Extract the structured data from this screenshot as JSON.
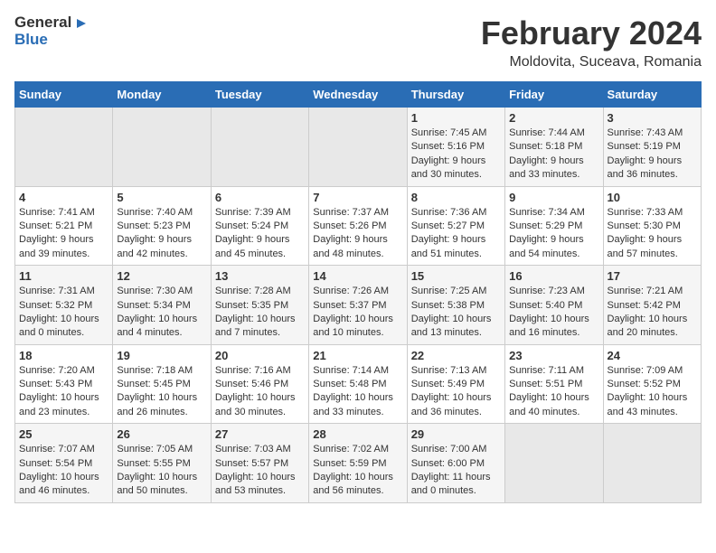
{
  "header": {
    "logo_general": "General",
    "logo_blue": "Blue",
    "title": "February 2024",
    "subtitle": "Moldovita, Suceava, Romania"
  },
  "calendar": {
    "days_of_week": [
      "Sunday",
      "Monday",
      "Tuesday",
      "Wednesday",
      "Thursday",
      "Friday",
      "Saturday"
    ],
    "weeks": [
      [
        {
          "day": "",
          "info": ""
        },
        {
          "day": "",
          "info": ""
        },
        {
          "day": "",
          "info": ""
        },
        {
          "day": "",
          "info": ""
        },
        {
          "day": "1",
          "info": "Sunrise: 7:45 AM\nSunset: 5:16 PM\nDaylight: 9 hours and 30 minutes."
        },
        {
          "day": "2",
          "info": "Sunrise: 7:44 AM\nSunset: 5:18 PM\nDaylight: 9 hours and 33 minutes."
        },
        {
          "day": "3",
          "info": "Sunrise: 7:43 AM\nSunset: 5:19 PM\nDaylight: 9 hours and 36 minutes."
        }
      ],
      [
        {
          "day": "4",
          "info": "Sunrise: 7:41 AM\nSunset: 5:21 PM\nDaylight: 9 hours and 39 minutes."
        },
        {
          "day": "5",
          "info": "Sunrise: 7:40 AM\nSunset: 5:23 PM\nDaylight: 9 hours and 42 minutes."
        },
        {
          "day": "6",
          "info": "Sunrise: 7:39 AM\nSunset: 5:24 PM\nDaylight: 9 hours and 45 minutes."
        },
        {
          "day": "7",
          "info": "Sunrise: 7:37 AM\nSunset: 5:26 PM\nDaylight: 9 hours and 48 minutes."
        },
        {
          "day": "8",
          "info": "Sunrise: 7:36 AM\nSunset: 5:27 PM\nDaylight: 9 hours and 51 minutes."
        },
        {
          "day": "9",
          "info": "Sunrise: 7:34 AM\nSunset: 5:29 PM\nDaylight: 9 hours and 54 minutes."
        },
        {
          "day": "10",
          "info": "Sunrise: 7:33 AM\nSunset: 5:30 PM\nDaylight: 9 hours and 57 minutes."
        }
      ],
      [
        {
          "day": "11",
          "info": "Sunrise: 7:31 AM\nSunset: 5:32 PM\nDaylight: 10 hours and 0 minutes."
        },
        {
          "day": "12",
          "info": "Sunrise: 7:30 AM\nSunset: 5:34 PM\nDaylight: 10 hours and 4 minutes."
        },
        {
          "day": "13",
          "info": "Sunrise: 7:28 AM\nSunset: 5:35 PM\nDaylight: 10 hours and 7 minutes."
        },
        {
          "day": "14",
          "info": "Sunrise: 7:26 AM\nSunset: 5:37 PM\nDaylight: 10 hours and 10 minutes."
        },
        {
          "day": "15",
          "info": "Sunrise: 7:25 AM\nSunset: 5:38 PM\nDaylight: 10 hours and 13 minutes."
        },
        {
          "day": "16",
          "info": "Sunrise: 7:23 AM\nSunset: 5:40 PM\nDaylight: 10 hours and 16 minutes."
        },
        {
          "day": "17",
          "info": "Sunrise: 7:21 AM\nSunset: 5:42 PM\nDaylight: 10 hours and 20 minutes."
        }
      ],
      [
        {
          "day": "18",
          "info": "Sunrise: 7:20 AM\nSunset: 5:43 PM\nDaylight: 10 hours and 23 minutes."
        },
        {
          "day": "19",
          "info": "Sunrise: 7:18 AM\nSunset: 5:45 PM\nDaylight: 10 hours and 26 minutes."
        },
        {
          "day": "20",
          "info": "Sunrise: 7:16 AM\nSunset: 5:46 PM\nDaylight: 10 hours and 30 minutes."
        },
        {
          "day": "21",
          "info": "Sunrise: 7:14 AM\nSunset: 5:48 PM\nDaylight: 10 hours and 33 minutes."
        },
        {
          "day": "22",
          "info": "Sunrise: 7:13 AM\nSunset: 5:49 PM\nDaylight: 10 hours and 36 minutes."
        },
        {
          "day": "23",
          "info": "Sunrise: 7:11 AM\nSunset: 5:51 PM\nDaylight: 10 hours and 40 minutes."
        },
        {
          "day": "24",
          "info": "Sunrise: 7:09 AM\nSunset: 5:52 PM\nDaylight: 10 hours and 43 minutes."
        }
      ],
      [
        {
          "day": "25",
          "info": "Sunrise: 7:07 AM\nSunset: 5:54 PM\nDaylight: 10 hours and 46 minutes."
        },
        {
          "day": "26",
          "info": "Sunrise: 7:05 AM\nSunset: 5:55 PM\nDaylight: 10 hours and 50 minutes."
        },
        {
          "day": "27",
          "info": "Sunrise: 7:03 AM\nSunset: 5:57 PM\nDaylight: 10 hours and 53 minutes."
        },
        {
          "day": "28",
          "info": "Sunrise: 7:02 AM\nSunset: 5:59 PM\nDaylight: 10 hours and 56 minutes."
        },
        {
          "day": "29",
          "info": "Sunrise: 7:00 AM\nSunset: 6:00 PM\nDaylight: 11 hours and 0 minutes."
        },
        {
          "day": "",
          "info": ""
        },
        {
          "day": "",
          "info": ""
        }
      ]
    ]
  }
}
